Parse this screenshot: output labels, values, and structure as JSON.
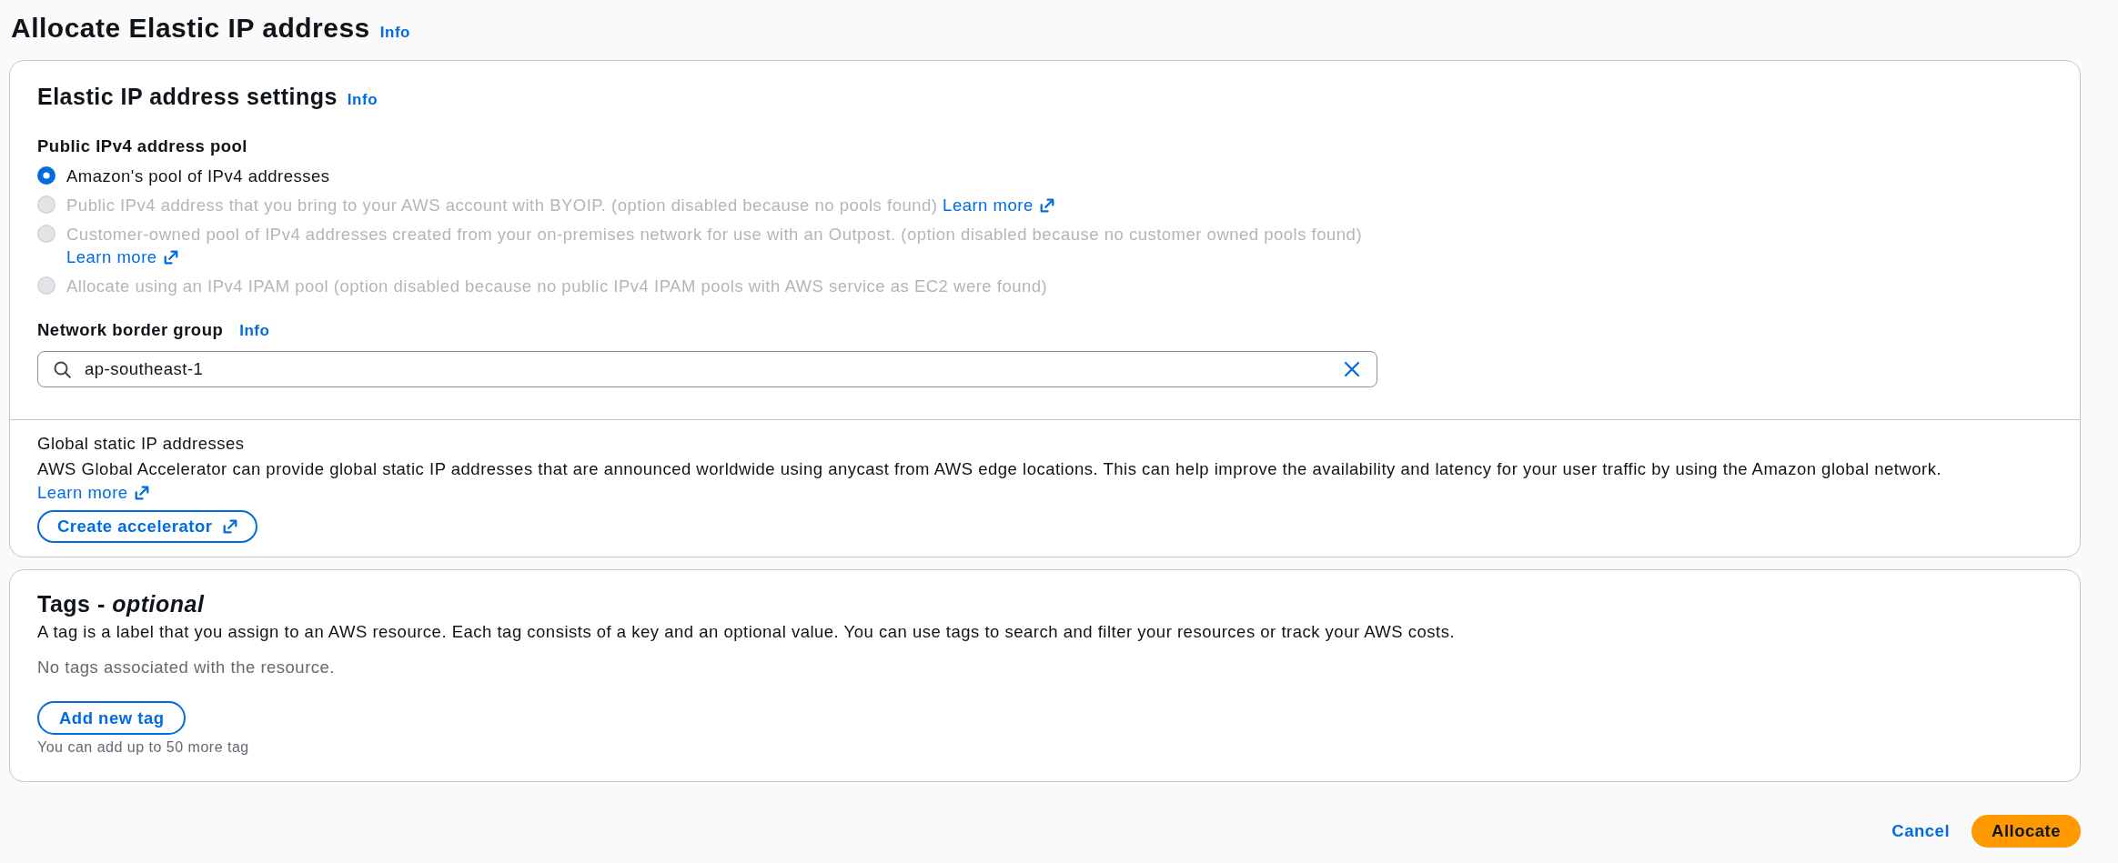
{
  "page": {
    "title": "Allocate Elastic IP address",
    "info_link": "Info"
  },
  "settings": {
    "title": "Elastic IP address settings",
    "info_link": "Info",
    "address_pool": {
      "label": "Public IPv4 address pool",
      "options": [
        {
          "text": "Amazon's pool of IPv4 addresses",
          "selected": true,
          "disabled": false
        },
        {
          "text": "Public IPv4 address that you bring to your AWS account with BYOIP. (option disabled because no pools found)",
          "link": "Learn more",
          "selected": false,
          "disabled": true
        },
        {
          "text": "Customer-owned pool of IPv4 addresses created from your on-premises network for use with an Outpost. (option disabled because no customer owned pools found)",
          "link": "Learn more",
          "selected": false,
          "disabled": true
        },
        {
          "text": "Allocate using an IPv4 IPAM pool (option disabled because no public IPv4 IPAM pools with AWS service as EC2 were found)",
          "selected": false,
          "disabled": true
        }
      ]
    },
    "network_border_group": {
      "label": "Network border group",
      "info_link": "Info",
      "value": "ap-southeast-1"
    },
    "global_static_ip": {
      "heading": "Global static IP addresses",
      "text": "AWS Global Accelerator can provide global static IP addresses that are announced worldwide using anycast from AWS edge locations. This can help improve the availability and latency for your user traffic by using the Amazon global network.",
      "link": "Learn more",
      "button": "Create accelerator"
    }
  },
  "tags": {
    "title": "Tags - *optional*",
    "description": "A tag is a label that you assign to an AWS resource. Each tag consists of a key and an optional value. You can use tags to search and filter your resources or track your AWS costs.",
    "empty_text": "No tags associated with the resource.",
    "button": "Add new tag",
    "limit_text": "You can add up to 50 more tag"
  },
  "actions": [
    {
      "label": "Cancel",
      "kind": "link"
    },
    {
      "label": "Allocate",
      "kind": "primary"
    }
  ]
}
